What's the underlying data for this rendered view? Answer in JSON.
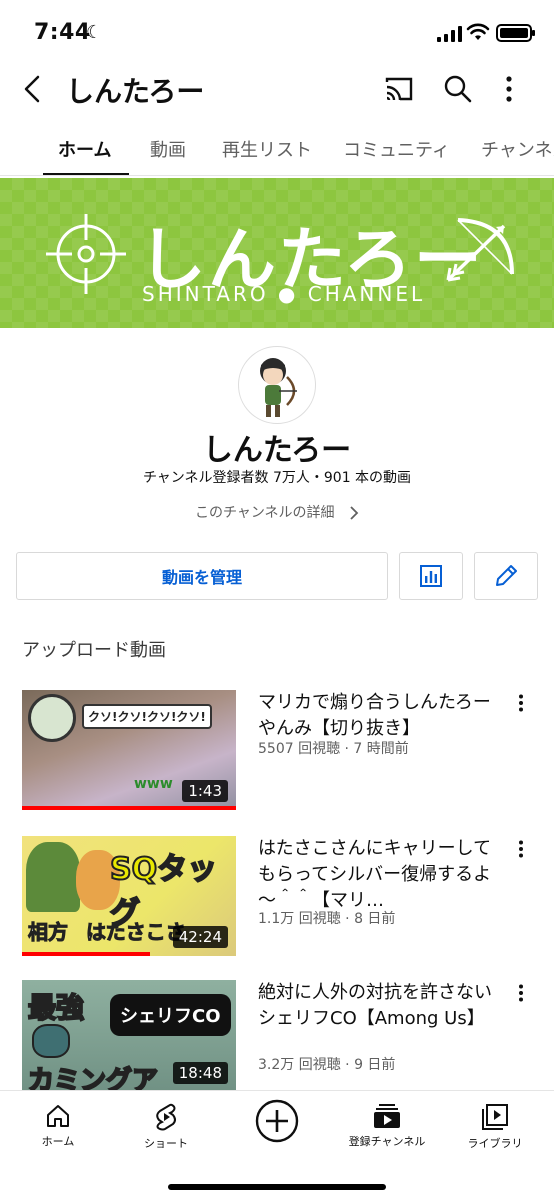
{
  "status_bar": {
    "time": "7:44"
  },
  "header": {
    "title": "しんたろー"
  },
  "tabs": [
    {
      "label": "ホーム"
    },
    {
      "label": "動画"
    },
    {
      "label": "再生リスト"
    },
    {
      "label": "コミュニティ"
    },
    {
      "label": "チャンネル"
    }
  ],
  "banner": {
    "name": "しんたろー",
    "subtitle": "SHINTARO ● CHANNEL"
  },
  "channel": {
    "name": "しんたろー",
    "meta": "チャンネル登録者数 7万人・901 本の動画",
    "detail_link": "このチャンネルの詳細"
  },
  "actions": {
    "manage_label": "動画を管理"
  },
  "uploads": {
    "section_title": "アップロード動画",
    "videos": [
      {
        "title": "マリカで煽り合うしんたろーやんみ【切り抜き】",
        "meta": "5507 回視聴 · 7 時間前",
        "duration": "1:43",
        "progress": 1.0,
        "thumb_text": [
          "クソ!クソ!クソ!クソ!",
          "www"
        ]
      },
      {
        "title": "はたさこさんにキャリーしてもらってシルバー復帰するよ～＾＾【マリ…",
        "meta": "1.1万 回視聴 · 8 日前",
        "duration": "42:24",
        "progress": 0.6,
        "thumb_text": [
          "SQタッグ",
          "相方",
          "はたさこさ"
        ]
      },
      {
        "title": "絶対に人外の対抗を許さないシェリフCO【Among Us】",
        "meta": "3.2万 回視聴 · 9 日前",
        "duration": "18:48",
        "progress": 0,
        "thumb_text": [
          "最強",
          "シェリフCO",
          "カミングア"
        ]
      }
    ]
  },
  "bottom_nav": [
    {
      "label": "ホーム",
      "icon": "home-icon"
    },
    {
      "label": "ショート",
      "icon": "shorts-icon"
    },
    {
      "label": "",
      "icon": "create-icon"
    },
    {
      "label": "登録チャンネル",
      "icon": "subscriptions-icon"
    },
    {
      "label": "ライブラリ",
      "icon": "library-icon"
    }
  ]
}
